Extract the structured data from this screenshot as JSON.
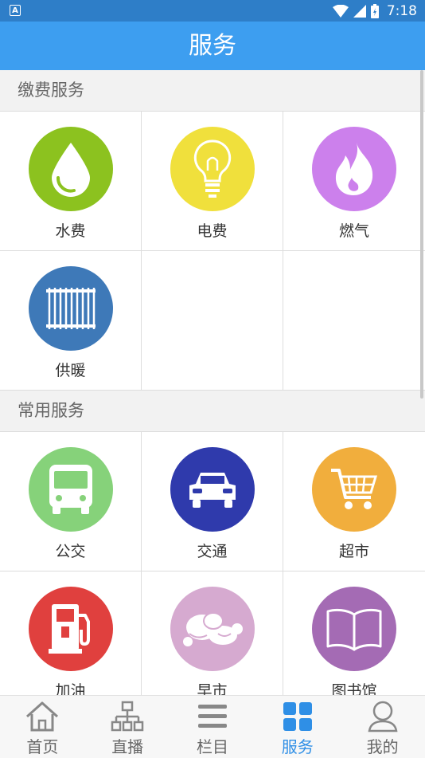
{
  "status_bar": {
    "time": "7:18",
    "app_icon_letter": "A"
  },
  "title": "服务",
  "sections": [
    {
      "header": "缴费服务",
      "items": [
        {
          "label": "水费",
          "icon": "water-drop-icon",
          "color": "#8cc21f"
        },
        {
          "label": "电费",
          "icon": "light-bulb-icon",
          "color": "#f0e03c"
        },
        {
          "label": "燃气",
          "icon": "flame-icon",
          "color": "#cc80ec"
        },
        {
          "label": "供暖",
          "icon": "radiator-icon",
          "color": "#3e79b8"
        }
      ]
    },
    {
      "header": "常用服务",
      "items": [
        {
          "label": "公交",
          "icon": "bus-icon",
          "color": "#86d27a"
        },
        {
          "label": "交通",
          "icon": "car-icon",
          "color": "#2f3aac"
        },
        {
          "label": "超市",
          "icon": "shopping-cart-icon",
          "color": "#f1ae3d"
        },
        {
          "label": "加油",
          "icon": "fuel-pump-icon",
          "color": "#e0403e"
        },
        {
          "label": "早市",
          "icon": "vegetables-icon",
          "color": "#d6aad0"
        },
        {
          "label": "图书馆",
          "icon": "book-icon",
          "color": "#a46bb4"
        }
      ]
    }
  ],
  "bottom_nav": [
    {
      "label": "首页",
      "icon": "home-icon",
      "active": false
    },
    {
      "label": "直播",
      "icon": "hierarchy-icon",
      "active": false
    },
    {
      "label": "栏目",
      "icon": "menu-lines-icon",
      "active": false
    },
    {
      "label": "服务",
      "icon": "grid-squares-icon",
      "active": true
    },
    {
      "label": "我的",
      "icon": "user-icon",
      "active": false
    }
  ],
  "colors": {
    "status_bar": "#2e7ec8",
    "title_bar": "#3d9ef0",
    "nav_active": "#2f8fe6"
  }
}
